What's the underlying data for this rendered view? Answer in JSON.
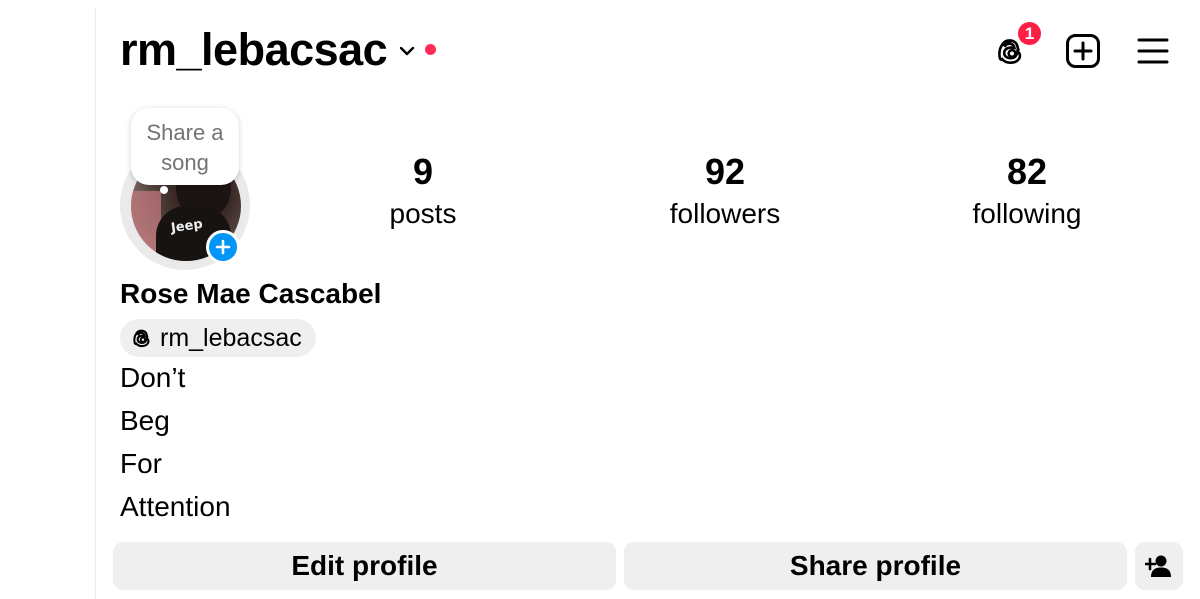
{
  "header": {
    "username": "rm_lebacsac",
    "threads_badge_count": "1"
  },
  "profile": {
    "note_text": "Share a song",
    "full_name": "Rose Mae Cascabel",
    "threads_handle": "rm_lebacsac",
    "bio_lines": [
      "Don’t",
      "Beg",
      "For",
      "Attention"
    ],
    "avatar_shirt_text": "Jeep"
  },
  "stats": {
    "posts": {
      "value": "9",
      "label": "posts"
    },
    "followers": {
      "value": "92",
      "label": "followers"
    },
    "following": {
      "value": "82",
      "label": "following"
    }
  },
  "actions": {
    "edit_profile": "Edit profile",
    "share_profile": "Share profile"
  },
  "icons": {
    "chevron": "chevron-down-icon",
    "threads": "threads-icon",
    "create": "plus-square-icon",
    "menu": "hamburger-menu-icon",
    "add_user": "add-user-icon",
    "story_add": "plus-icon"
  },
  "colors": {
    "notification_red": "#ff2c55",
    "badge_red": "#ff1f44",
    "accent_blue": "#0095f6",
    "button_gray": "#efefef"
  }
}
